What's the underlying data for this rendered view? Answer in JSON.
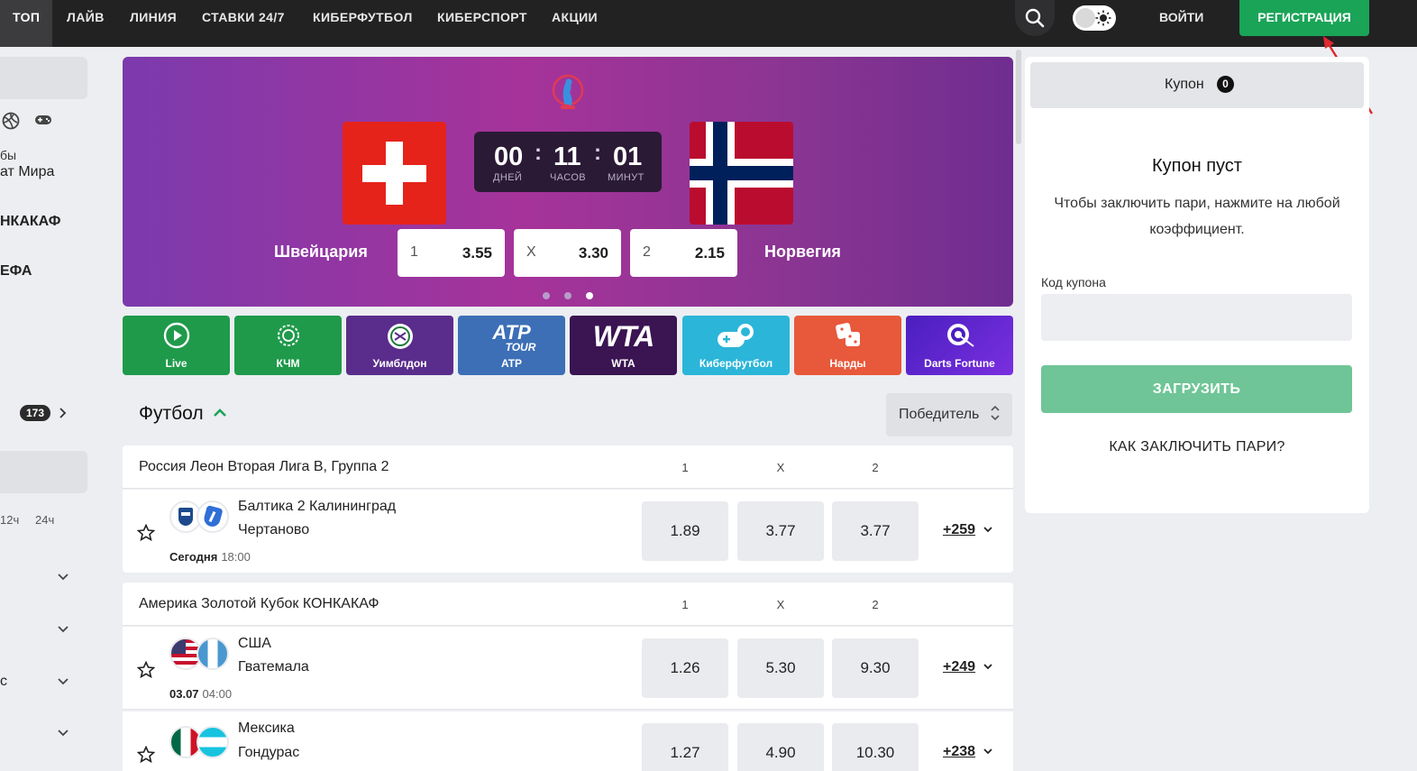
{
  "nav": {
    "items": [
      "ТОП",
      "ЛАЙВ",
      "ЛИНИЯ",
      "СТАВКИ 24/7",
      "КИБЕРФУТБОЛ",
      "КИБЕРСПОРТ",
      "АКЦИИ"
    ],
    "login": "ВОЙТИ",
    "register": "РЕГИСТРАЦИЯ"
  },
  "sidebar": {
    "texts": [
      "бы",
      "ат Мира",
      "НКАКАФ",
      "ЕФА",
      "с"
    ],
    "count": "173",
    "time_filters": [
      "12ч",
      "24ч"
    ]
  },
  "banner": {
    "timer": {
      "days": "00",
      "days_label": "ДНЕЙ",
      "hours": "11",
      "hours_label": "ЧАСОВ",
      "minutes": "01",
      "minutes_label": "МИНУТ"
    },
    "home_team": "Швейцария",
    "away_team": "Норвегия",
    "odds": [
      {
        "key": "1",
        "value": "3.55"
      },
      {
        "key": "X",
        "value": "3.30"
      },
      {
        "key": "2",
        "value": "2.15"
      }
    ]
  },
  "tiles": [
    {
      "label": "Live",
      "color": "#1f9a4b"
    },
    {
      "label": "КЧМ",
      "color": "#1f9a4b"
    },
    {
      "label": "Уимблдон",
      "color": "#5a2d8c"
    },
    {
      "label": "ATP",
      "color": "#3c6fb6"
    },
    {
      "label": "WTA",
      "color": "#3b1452"
    },
    {
      "label": "Киберфутбол",
      "color": "#2bb5d8"
    },
    {
      "label": "Нарды",
      "color": "#e8583a"
    },
    {
      "label": "Darts Fortune",
      "color": "#5a23c8"
    }
  ],
  "section": {
    "title": "Футбол",
    "market": "Победитель"
  },
  "leagues": [
    {
      "country": "Россия",
      "name": "Леон Вторая Лига В, Группа 2",
      "cols": [
        "1",
        "X",
        "2"
      ],
      "matches": [
        {
          "team1": "Балтика 2 Калининград",
          "team2": "Чертаново",
          "date": "Сегодня",
          "time": "18:00",
          "odds": [
            "1.89",
            "3.77",
            "3.77"
          ],
          "more": "+259"
        }
      ]
    },
    {
      "country": "Америка",
      "name": "Золотой Кубок КОНКАКАФ",
      "cols": [
        "1",
        "X",
        "2"
      ],
      "matches": [
        {
          "team1": "США",
          "team2": "Гватемала",
          "date": "03.07",
          "time": "04:00",
          "odds": [
            "1.26",
            "5.30",
            "9.30"
          ],
          "more": "+249"
        },
        {
          "team1": "Мексика",
          "team2": "Гондурас",
          "date": "",
          "time": "",
          "odds": [
            "1.27",
            "4.90",
            "10.30"
          ],
          "more": "+238"
        }
      ]
    }
  ],
  "coupon": {
    "tab_label": "Купон",
    "count": "0",
    "empty_title": "Купон пуст",
    "empty_desc": "Чтобы заключить пари, нажмите на любой коэффициент.",
    "code_label": "Код купона",
    "code_value": "",
    "load_button": "ЗАГРУЗИТЬ",
    "how_link": "КАК ЗАКЛЮЧИТЬ ПАРИ?"
  },
  "icons": [
    "search-icon",
    "sun-icon",
    "volleyball-icon",
    "gamepad-icon",
    "chevron-right-icon",
    "chevron-down-icon",
    "chevron-up-icon",
    "star-icon",
    "sort-icon"
  ]
}
